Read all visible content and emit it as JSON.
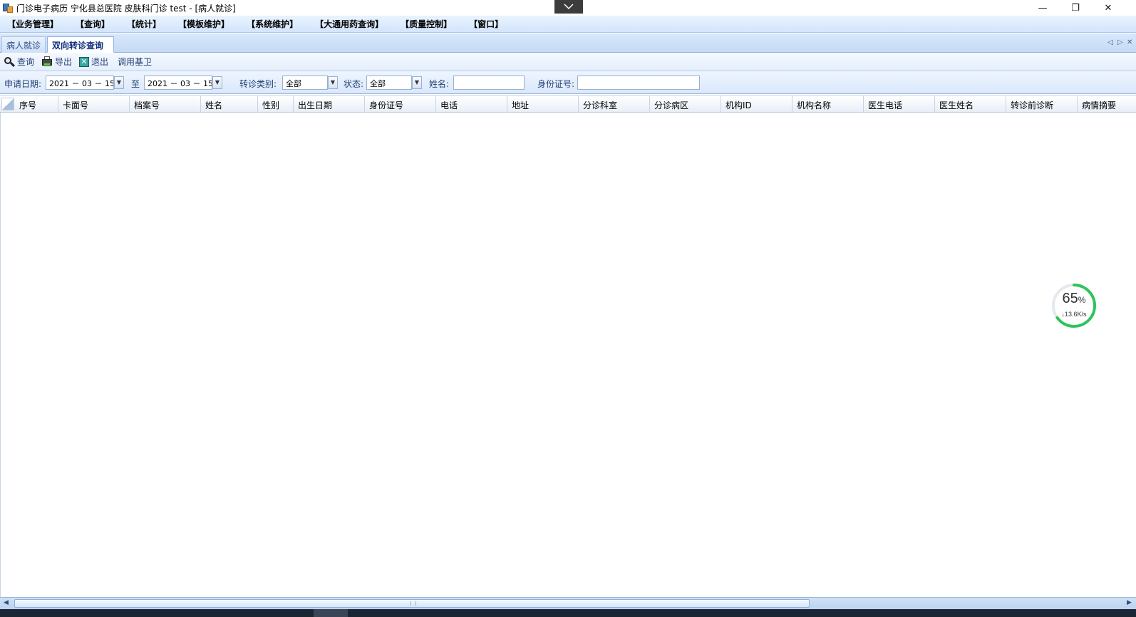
{
  "window": {
    "title": "门诊电子病历  宁化县总医院  皮肤科门诊  test - [病人就诊]",
    "dropdown_icon": "chevron-down-icon",
    "controls": {
      "minimize": "—",
      "restore": "❐",
      "close": "✕"
    }
  },
  "menu": [
    "【业务管理】",
    "【查询】",
    "【统计】",
    "【模板维护】",
    "【系统维护】",
    "【大通用药查询】",
    "【质量控制】",
    "【窗口】"
  ],
  "tabs": {
    "items": [
      "病人就诊",
      "双向转诊查询"
    ],
    "active_index": 1,
    "nav": {
      "left": "◁",
      "right": "▷",
      "close": "✕"
    }
  },
  "toolbar": {
    "query": "查询",
    "export": "导出",
    "exit": "退出",
    "call_jiwei": "调用基卫"
  },
  "filters": {
    "apply_date_label": "申请日期:",
    "date_from": "2021 － 03 － 15",
    "to_label": "至",
    "date_to": "2021 － 03 － 15",
    "referral_type_label": "转诊类别:",
    "referral_type_value": "全部",
    "status_label": "状态:",
    "status_value": "全部",
    "name_label": "姓名:",
    "name_value": "",
    "id_card_label": "身份证号:",
    "id_card_value": ""
  },
  "grid": {
    "columns": [
      "序号",
      "卡面号",
      "档案号",
      "姓名",
      "性别",
      "出生日期",
      "身份证号",
      "电话",
      "地址",
      "分诊科室",
      "分诊病区",
      "机构ID",
      "机构名称",
      "医生电话",
      "医生姓名",
      "转诊前诊断",
      "病情摘要"
    ],
    "rows": []
  },
  "network_widget": {
    "percent": 65,
    "percent_number": "65",
    "percent_sign": "%",
    "speed": "↓13.6K/s"
  },
  "scrollbar": {
    "left": "◀",
    "right": "▶"
  },
  "colors": {
    "accent": "#2a4d86",
    "menubar": "#d3e5fb",
    "progress_ring": "#2ec45a"
  }
}
